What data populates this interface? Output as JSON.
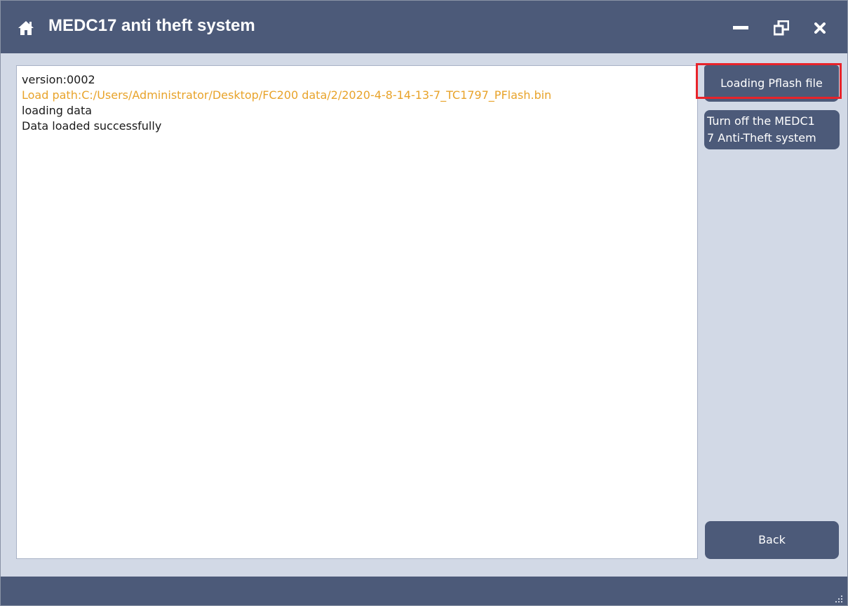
{
  "window": {
    "title": "MEDC17 anti theft system",
    "icons": {
      "home": "home-icon",
      "minimize": "minimize-icon",
      "restore": "restore-icon",
      "close": "close-icon"
    }
  },
  "log": {
    "lines": [
      {
        "text": "version:0002",
        "type": "normal"
      },
      {
        "text": "Load path:C:/Users/Administrator/Desktop/FC200 data/2/2020-4-8-14-13-7_TC1797_PFlash.bin",
        "type": "path"
      },
      {
        "text": "loading data",
        "type": "normal"
      },
      {
        "text": "Data loaded successfully",
        "type": "normal"
      }
    ]
  },
  "side": {
    "load_label": "Loading Pflash file",
    "turnoff_label": "Turn off the MEDC1\n7 Anti-Theft system",
    "back_label": "Back"
  },
  "colors": {
    "titlebar": "#4c5a79",
    "background": "#d2d9e6",
    "path_text": "#e8a32a",
    "highlight": "#e8232a"
  }
}
